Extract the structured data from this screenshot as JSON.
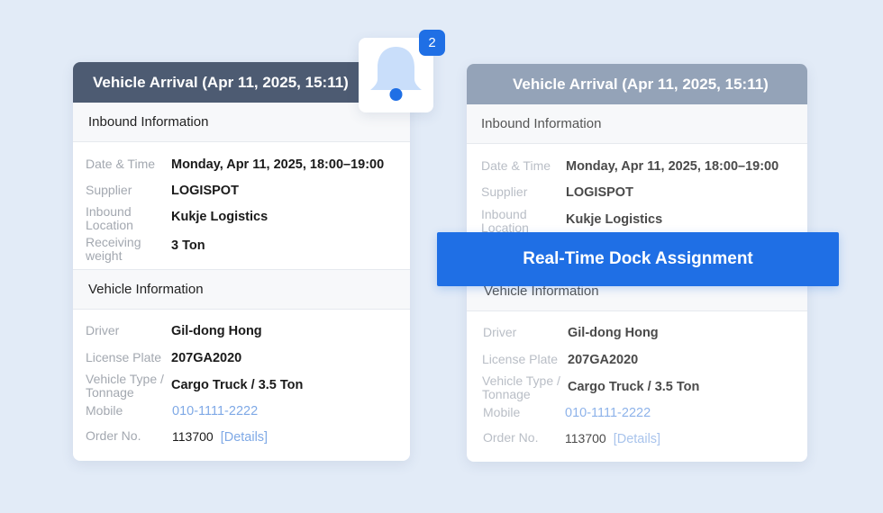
{
  "notification": {
    "icon": "bell-icon",
    "count": "2",
    "accent_color": "#1f6fe5"
  },
  "banner": {
    "label": "Real-Time Dock Assignment"
  },
  "cards": [
    {
      "title": "Vehicle Arrival (Apr 11, 2025, 15:11)",
      "inbound": {
        "heading": "Inbound Information",
        "date_label": "Date & Time",
        "date_value": "Monday, Apr 11, 2025, 18:00–19:00",
        "supplier_label": "Supplier",
        "supplier_value": "LOGISPOT",
        "location_label": "Inbound Location",
        "location_value": "Kukje Logistics",
        "weight_label": "Receiving weight",
        "weight_value": "3 Ton"
      },
      "vehicle": {
        "heading": "Vehicle Information",
        "driver_label": "Driver",
        "driver_value": "Gil-dong Hong",
        "plate_label": "License Plate",
        "plate_value": "207GA2020",
        "type_label": "Vehicle Type / Tonnage",
        "type_value": "Cargo Truck / 3.5 Ton",
        "mobile_label": "Mobile",
        "mobile_value": "010-1111-2222",
        "order_label": "Order No.",
        "order_value": "113700",
        "details_link": "[Details]"
      }
    },
    {
      "title": "Vehicle Arrival (Apr 11, 2025, 15:11)",
      "inbound": {
        "heading": "Inbound Information",
        "date_label": "Date & Time",
        "date_value": "Monday, Apr 11, 2025, 18:00–19:00",
        "supplier_label": "Supplier",
        "supplier_value": "LOGISPOT",
        "location_label": "Inbound Location",
        "location_value": "Kukje Logistics"
      },
      "vehicle": {
        "heading": "Vehicle Information",
        "driver_label": "Driver",
        "driver_value": "Gil-dong Hong",
        "plate_label": "License Plate",
        "plate_value": "207GA2020",
        "type_label": "Vehicle Type / Tonnage",
        "type_value": "Cargo Truck / 3.5 Ton",
        "mobile_label": "Mobile",
        "mobile_value": "010-1111-2222",
        "order_label": "Order No.",
        "order_value": "113700",
        "details_link": "[Details]"
      }
    }
  ]
}
